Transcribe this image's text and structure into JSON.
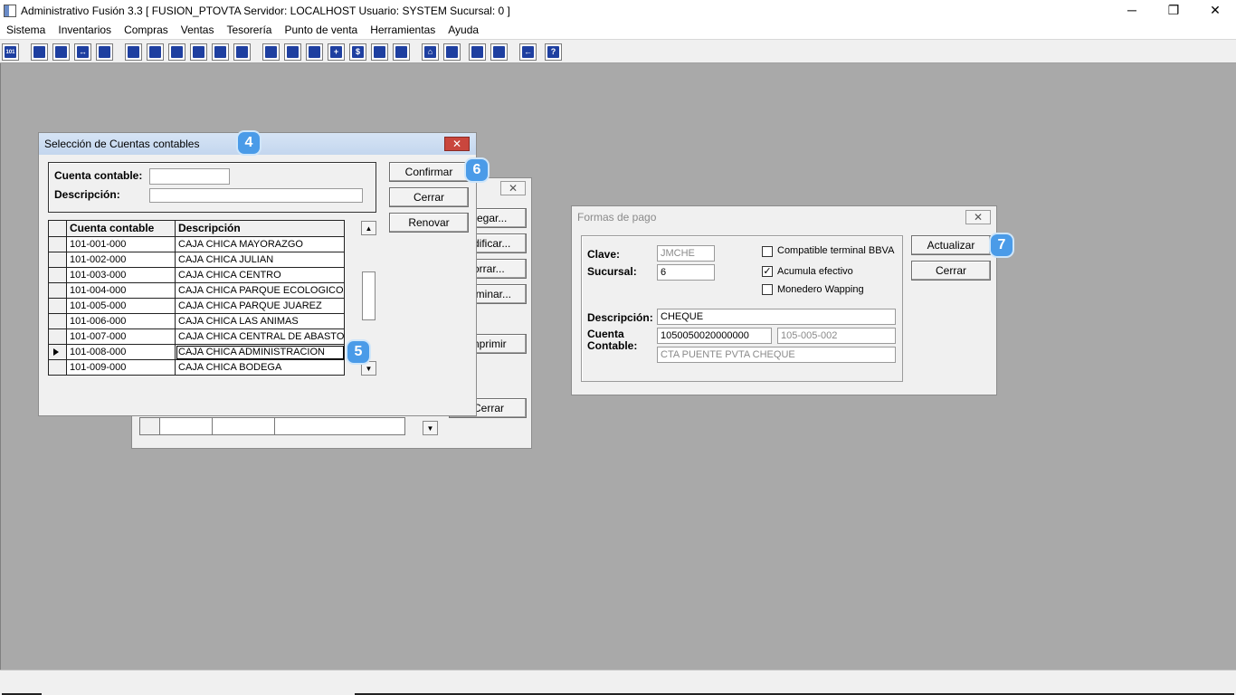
{
  "window": {
    "title": "Administrativo Fusión 3.3 [ FUSION_PTOVTA   Servidor: LOCALHOST   Usuario: SYSTEM     Sucursal: 0 ]",
    "minimize": "─",
    "restore": "❐",
    "close": "✕"
  },
  "menu": [
    "Sistema",
    "Inventarios",
    "Compras",
    "Ventas",
    "Tesorería",
    "Punto de venta",
    "Herramientas",
    "Ayuda"
  ],
  "toolbar": {
    "icons": [
      "calculator-icon",
      "copy-icon",
      "clipboard-icon",
      "transfer-icon",
      "search-doc-icon",
      "user-icon",
      "folder-icon",
      "import-icon",
      "print-icon",
      "document-icon",
      "list-icon",
      "binoculars-icon",
      "box-icon",
      "export-icon",
      "add-icon",
      "dollar-icon",
      "report-icon",
      "table-icon",
      "home-icon",
      "find-icon",
      "refresh-icon",
      "undo-icon",
      "back-icon",
      "help-icon"
    ],
    "glyphs": [
      "101",
      "",
      "",
      "↔",
      "",
      "",
      "",
      "",
      "",
      "",
      "",
      "",
      "",
      "",
      "+",
      "$",
      "",
      "",
      "⌂",
      "",
      "",
      "",
      "←",
      "?"
    ]
  },
  "seleccion": {
    "title": "Selección de Cuentas contables",
    "close": "✕",
    "cuenta_label": "Cuenta contable:",
    "descripcion_label": "Descripción:",
    "cuenta_value": "",
    "descripcion_value": "",
    "buttons": {
      "confirmar": "Confirmar",
      "cerrar": "Cerrar",
      "renovar": "Renovar"
    },
    "columns": [
      "Cuenta contable",
      "Descripción"
    ],
    "rows": [
      {
        "cuenta": "101-001-000",
        "desc": "CAJA CHICA MAYORAZGO"
      },
      {
        "cuenta": "101-002-000",
        "desc": "CAJA CHICA JULIAN"
      },
      {
        "cuenta": "101-003-000",
        "desc": "CAJA CHICA CENTRO"
      },
      {
        "cuenta": "101-004-000",
        "desc": "CAJA CHICA PARQUE ECOLOGICO"
      },
      {
        "cuenta": "101-005-000",
        "desc": "CAJA CHICA PARQUE JUAREZ"
      },
      {
        "cuenta": "101-006-000",
        "desc": "CAJA CHICA LAS ANIMAS"
      },
      {
        "cuenta": "101-007-000",
        "desc": "CAJA CHICA CENTRAL DE ABASTO"
      },
      {
        "cuenta": "101-008-000",
        "desc": "CAJA CHICA ADMINISTRACION"
      },
      {
        "cuenta": "101-009-000",
        "desc": "CAJA CHICA BODEGA"
      }
    ],
    "selected_row": 7,
    "scroll_up": "▲",
    "scroll_down": "▼"
  },
  "behind": {
    "close": "✕",
    "buttons": [
      "regar...",
      "dificar...",
      "orrar...",
      "iminar...",
      "nprimir",
      "Cerrar"
    ],
    "scroll_down": "▼"
  },
  "formas": {
    "title": "Formas de pago",
    "close": "✕",
    "clave_label": "Clave:",
    "clave_value": "JMCHE",
    "sucursal_label": "Sucursal:",
    "sucursal_value": "6",
    "checks": [
      {
        "label": "Compatible terminal BBVA",
        "checked": false,
        "mark": ""
      },
      {
        "label": "Acumula efectivo",
        "checked": true,
        "mark": "✓"
      },
      {
        "label": "Monedero Wapping",
        "checked": false,
        "mark": ""
      }
    ],
    "descripcion_label": "Descripción:",
    "descripcion_value": "CHEQUE",
    "cuenta_label_1": "Cuenta",
    "cuenta_label_2": "Contable:",
    "cuenta_value": "1050050020000000",
    "cuenta_code": "105-005-002",
    "cuenta_name": "CTA PUENTE PVTA CHEQUE",
    "buttons": {
      "actualizar": "Actualizar",
      "cerrar": "Cerrar"
    }
  },
  "badges": [
    "4",
    "5",
    "6",
    "7"
  ],
  "colors": {
    "badge": "#4a9be8",
    "desktop": "#a9a9a9",
    "title_gradient": "#c3d6ee"
  }
}
